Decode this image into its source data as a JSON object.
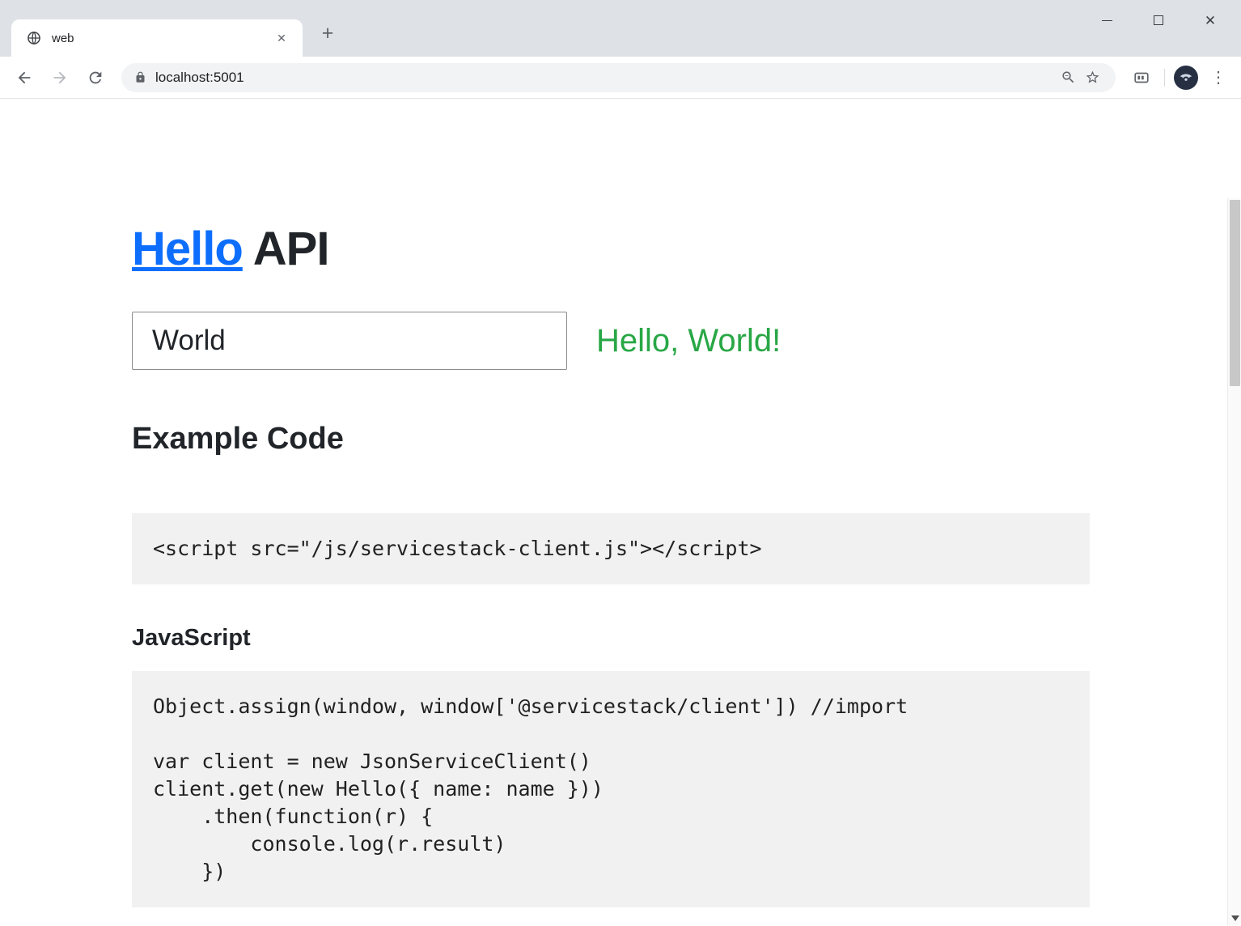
{
  "window": {
    "tab_title": "web",
    "url": "localhost:5001",
    "icons": {
      "tab_close": "✕",
      "new_tab": "+",
      "close": "✕",
      "menu": "⋮"
    }
  },
  "page": {
    "title_link": "Hello",
    "title_rest": "API",
    "name_value": "World",
    "greeting": "Hello, World!",
    "section_heading": "Example Code",
    "include_code": "<script src=\"/js/servicestack-client.js\"></script>",
    "js_heading": "JavaScript",
    "js_code": "Object.assign(window, window['@servicestack/client']) //import\n\nvar client = new JsonServiceClient()\nclient.get(new Hello({ name: name }))\n    .then(function(r) {\n        console.log(r.result)\n    })"
  },
  "colors": {
    "link_blue": "#0d6efd",
    "greeting_green": "#28a745",
    "code_background": "#f1f1f1",
    "titlebar_gray": "#dee1e6",
    "omnibox_gray": "#f1f3f4"
  }
}
